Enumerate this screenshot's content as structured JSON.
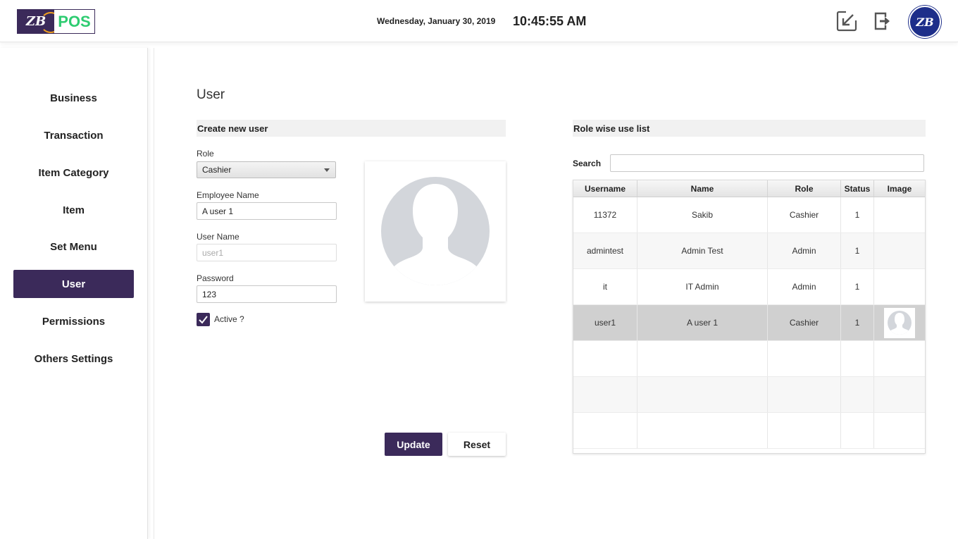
{
  "header": {
    "logo_text": "POS",
    "logo_mark": "ZB",
    "date": "Wednesday, January 30, 2019",
    "time": "10:45:55 AM",
    "icons": [
      "dashboard-grid-icon",
      "minimize-window-icon",
      "logout-icon",
      "user-avatar"
    ],
    "accent_green": "#2ecc71",
    "brand_color": "#3b2a5a"
  },
  "sidebar": {
    "items": [
      {
        "label": "Business"
      },
      {
        "label": "Transaction"
      },
      {
        "label": "Item Category"
      },
      {
        "label": "Item"
      },
      {
        "label": "Set Menu"
      },
      {
        "label": "User",
        "active": true
      },
      {
        "label": "Permissions"
      },
      {
        "label": "Others Settings"
      }
    ]
  },
  "page": {
    "title": "User"
  },
  "create_form": {
    "section_title": "Create new user",
    "role_label": "Role",
    "role_value": "Cashier",
    "employee_name_label": "Employee Name",
    "employee_name_value": "A user 1",
    "user_name_label": "User Name",
    "user_name_placeholder": "user1",
    "password_label": "Password",
    "password_value": "123",
    "active_label": "Active ?",
    "active_checked": true,
    "update_label": "Update",
    "reset_label": "Reset"
  },
  "user_list": {
    "section_title": "Role wise use list",
    "search_label": "Search",
    "search_value": "",
    "columns": [
      "Username",
      "Name",
      "Role",
      "Status",
      "Image"
    ],
    "rows": [
      {
        "username": "11372",
        "name": "Sakib",
        "role": "Cashier",
        "status": "1",
        "has_image": false
      },
      {
        "username": "admintest",
        "name": "Admin Test",
        "role": "Admin",
        "status": "1",
        "has_image": false
      },
      {
        "username": "it",
        "name": "IT Admin",
        "role": "Admin",
        "status": "1",
        "has_image": false
      },
      {
        "username": "user1",
        "name": "A user 1",
        "role": "Cashier",
        "status": "1",
        "has_image": true,
        "selected": true
      }
    ]
  }
}
